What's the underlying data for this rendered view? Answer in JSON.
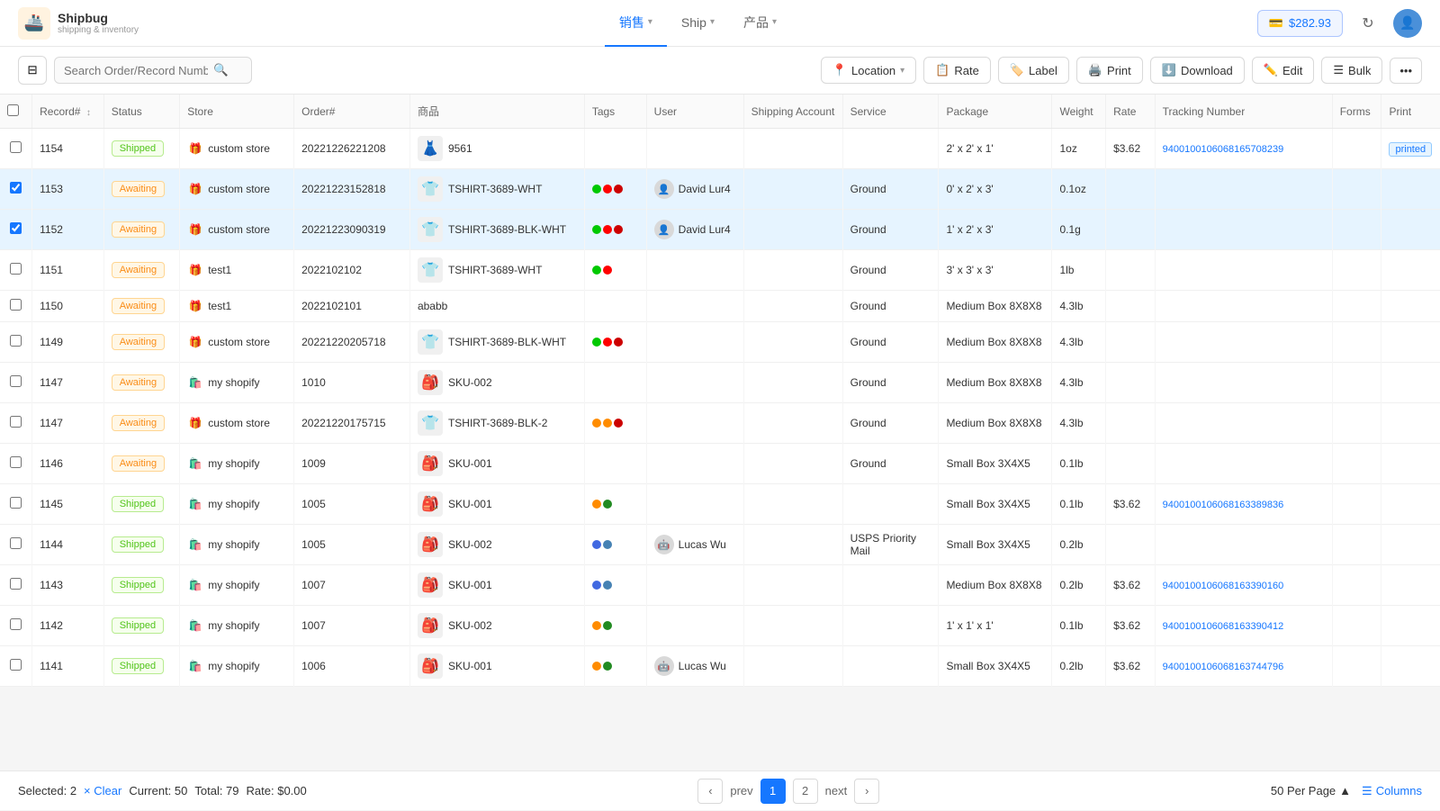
{
  "app": {
    "logo_icon": "🚢",
    "logo_title": "Shipbug",
    "logo_subtitle": "shipping & inventory"
  },
  "nav": {
    "items": [
      {
        "id": "sales",
        "label": "销售",
        "active": true,
        "has_dropdown": true
      },
      {
        "id": "ship",
        "label": "Ship",
        "active": false,
        "has_dropdown": true
      },
      {
        "id": "products",
        "label": "产品",
        "active": false,
        "has_dropdown": true
      }
    ]
  },
  "header": {
    "balance": "$282.93",
    "balance_icon": "💳",
    "refresh_icon": "↻",
    "avatar_text": "U"
  },
  "toolbar": {
    "search_placeholder": "Search Order/Record Number",
    "filter_icon": "⊟",
    "search_icon": "🔍",
    "buttons": [
      {
        "id": "location",
        "label": "Location",
        "icon": "📍",
        "has_dropdown": true
      },
      {
        "id": "rate",
        "label": "Rate",
        "icon": "📋"
      },
      {
        "id": "label",
        "label": "Label",
        "icon": "🏷️"
      },
      {
        "id": "print",
        "label": "Print",
        "icon": "🖨️"
      },
      {
        "id": "download",
        "label": "Download",
        "icon": "⬇️"
      },
      {
        "id": "edit",
        "label": "Edit",
        "icon": "✏️"
      },
      {
        "id": "bulk",
        "label": "Bulk",
        "icon": "☰"
      },
      {
        "id": "more",
        "label": "...",
        "icon": ""
      }
    ]
  },
  "table": {
    "columns": [
      "Record#",
      "Status",
      "Store",
      "Order#",
      "商品",
      "Tags",
      "User",
      "Shipping Account",
      "Service",
      "Package",
      "Weight",
      "Rate",
      "Tracking Number",
      "Forms",
      "Print"
    ],
    "rows": [
      {
        "id": 1154,
        "status": "Shipped",
        "status_type": "shipped",
        "store": "custom store",
        "store_icon": "🎁",
        "order": "20221226221208",
        "product": "9561",
        "product_img": "👗",
        "tags": [],
        "user": "",
        "shipping_account": "",
        "service": "",
        "package": "2' x 2' x 1'",
        "weight": "1oz",
        "rate": "$3.62",
        "tracking": "9400100106068165708239",
        "forms": "",
        "print_status": "printed",
        "checked": false,
        "row_selected": false
      },
      {
        "id": 1153,
        "status": "Awaiting",
        "status_type": "awaiting",
        "store": "custom store",
        "store_icon": "🎁",
        "order": "20221223152818",
        "product": "TSHIRT-3689-WHT",
        "product_img": "👕",
        "tags": [
          "#00c900",
          "#ff0000",
          "#cc0000"
        ],
        "user": "David Lur4",
        "user_avatar": "👤",
        "shipping_account": "",
        "service": "Ground",
        "package": "0' x 2' x 3'",
        "weight": "0.1oz",
        "rate": "",
        "tracking": "",
        "forms": "",
        "print_status": "",
        "checked": true,
        "row_selected": true
      },
      {
        "id": 1152,
        "status": "Awaiting",
        "status_type": "awaiting",
        "store": "custom store",
        "store_icon": "🎁",
        "order": "20221223090319",
        "product": "TSHIRT-3689-BLK-WHT",
        "product_img": "👕",
        "tags": [
          "#00c900",
          "#ff0000",
          "#cc0000"
        ],
        "user": "David Lur4",
        "user_avatar": "👤",
        "shipping_account": "",
        "service": "Ground",
        "package": "1' x 2' x 3'",
        "weight": "0.1g",
        "rate": "",
        "tracking": "",
        "forms": "",
        "print_status": "",
        "checked": true,
        "row_selected": true
      },
      {
        "id": 1151,
        "status": "Awaiting",
        "status_type": "awaiting",
        "store": "test1",
        "store_icon": "🎁",
        "order": "2022102102",
        "product": "TSHIRT-3689-WHT",
        "product_img": "👕",
        "tags": [
          "#00c900",
          "#ff0000"
        ],
        "user": "",
        "shipping_account": "",
        "service": "Ground",
        "package": "3' x 3' x 3'",
        "weight": "1lb",
        "rate": "",
        "tracking": "",
        "forms": "",
        "print_status": "",
        "checked": false,
        "row_selected": false
      },
      {
        "id": 1150,
        "status": "Awaiting",
        "status_type": "awaiting",
        "store": "test1",
        "store_icon": "🎁",
        "order": "2022102101",
        "product": "ababb",
        "product_img": "",
        "tags": [],
        "user": "",
        "shipping_account": "",
        "service": "Ground",
        "package": "Medium Box 8X8X8",
        "weight": "4.3lb",
        "rate": "",
        "tracking": "",
        "forms": "",
        "print_status": "",
        "checked": false,
        "row_selected": false
      },
      {
        "id": 1149,
        "status": "Awaiting",
        "status_type": "awaiting",
        "store": "custom store",
        "store_icon": "🎁",
        "order": "20221220205718",
        "product": "TSHIRT-3689-BLK-WHT",
        "product_img": "👕",
        "tags": [
          "#00c900",
          "#ff0000",
          "#cc0000"
        ],
        "user": "",
        "shipping_account": "",
        "service": "Ground",
        "package": "Medium Box 8X8X8",
        "weight": "4.3lb",
        "rate": "",
        "tracking": "",
        "forms": "",
        "print_status": "",
        "checked": false,
        "row_selected": false
      },
      {
        "id": 1147,
        "status": "Awaiting",
        "status_type": "awaiting",
        "store": "my shopify",
        "store_icon": "🛍️",
        "order": "1010",
        "product": "SKU-002",
        "product_img": "🎒",
        "tags": [],
        "user": "",
        "shipping_account": "",
        "service": "Ground",
        "package": "Medium Box 8X8X8",
        "weight": "4.3lb",
        "rate": "",
        "tracking": "",
        "forms": "",
        "print_status": "",
        "checked": false,
        "row_selected": false
      },
      {
        "id": 1147,
        "status": "Awaiting",
        "status_type": "awaiting",
        "store": "custom store",
        "store_icon": "🎁",
        "order": "20221220175715",
        "product": "TSHIRT-3689-BLK-2",
        "product_img": "👕",
        "tags": [
          "#ff8c00",
          "#ff8c00",
          "#cc0000"
        ],
        "user": "",
        "shipping_account": "",
        "service": "Ground",
        "package": "Medium Box 8X8X8",
        "weight": "4.3lb",
        "rate": "",
        "tracking": "",
        "forms": "",
        "print_status": "",
        "checked": false,
        "row_selected": false
      },
      {
        "id": 1146,
        "status": "Awaiting",
        "status_type": "awaiting",
        "store": "my shopify",
        "store_icon": "🛍️",
        "order": "1009",
        "product": "SKU-001",
        "product_img": "🎒",
        "tags": [],
        "user": "",
        "shipping_account": "",
        "service": "Ground",
        "package": "Small Box 3X4X5",
        "weight": "0.1lb",
        "rate": "",
        "tracking": "",
        "forms": "",
        "print_status": "",
        "checked": false,
        "row_selected": false
      },
      {
        "id": 1145,
        "status": "Shipped",
        "status_type": "shipped",
        "store": "my shopify",
        "store_icon": "🛍️",
        "order": "1005",
        "product": "SKU-001",
        "product_img": "🎒",
        "tags": [
          "#ff8c00",
          "#228b22"
        ],
        "user": "",
        "shipping_account": "",
        "service": "",
        "package": "Small Box 3X4X5",
        "weight": "0.1lb",
        "rate": "$3.62",
        "tracking": "9400100106068163389836",
        "forms": "",
        "print_status": "",
        "checked": false,
        "row_selected": false
      },
      {
        "id": 1144,
        "status": "Shipped",
        "status_type": "shipped",
        "store": "my shopify",
        "store_icon": "🛍️",
        "order": "1005",
        "product": "SKU-002",
        "product_img": "🎒",
        "tags": [
          "#4169e1",
          "#4682b4"
        ],
        "user": "Lucas Wu",
        "user_avatar": "🤖",
        "shipping_account": "",
        "service": "USPS Priority Mail",
        "package": "Small Box 3X4X5",
        "weight": "0.2lb",
        "rate": "",
        "tracking": "",
        "forms": "",
        "print_status": "",
        "checked": false,
        "row_selected": false
      },
      {
        "id": 1143,
        "status": "Shipped",
        "status_type": "shipped",
        "store": "my shopify",
        "store_icon": "🛍️",
        "order": "1007",
        "product": "SKU-001",
        "product_img": "🎒",
        "tags": [
          "#4169e1",
          "#4682b4"
        ],
        "user": "",
        "shipping_account": "",
        "service": "",
        "package": "Medium Box 8X8X8",
        "weight": "0.2lb",
        "rate": "$3.62",
        "tracking": "9400100106068163390160",
        "forms": "",
        "print_status": "",
        "checked": false,
        "row_selected": false
      },
      {
        "id": 1142,
        "status": "Shipped",
        "status_type": "shipped",
        "store": "my shopify",
        "store_icon": "🛍️",
        "order": "1007",
        "product": "SKU-002",
        "product_img": "🎒",
        "tags": [
          "#ff8c00",
          "#228b22"
        ],
        "user": "",
        "shipping_account": "",
        "service": "",
        "package": "1' x 1' x 1'",
        "weight": "0.1lb",
        "rate": "$3.62",
        "tracking": "9400100106068163390412",
        "forms": "",
        "print_status": "",
        "checked": false,
        "row_selected": false
      },
      {
        "id": 1141,
        "status": "Shipped",
        "status_type": "shipped",
        "store": "my shopify",
        "store_icon": "🛍️",
        "order": "1006",
        "product": "SKU-001",
        "product_img": "🎒",
        "tags": [
          "#ff8c00",
          "#228b22"
        ],
        "user": "Lucas Wu",
        "user_avatar": "🤖",
        "shipping_account": "",
        "service": "",
        "package": "Small Box 3X4X5",
        "weight": "0.2lb",
        "rate": "$3.62",
        "tracking": "9400100106068163744796",
        "forms": "",
        "print_status": "",
        "checked": false,
        "row_selected": false
      }
    ]
  },
  "footer": {
    "selected_count": "Selected: 2",
    "clear_label": "× Clear",
    "current": "Current: 50",
    "total": "Total: 79",
    "rate_info": "Rate: $0.00",
    "prev_label": "prev",
    "next_label": "next",
    "current_page": 1,
    "total_pages": 2,
    "per_page": "50 Per Page",
    "columns_label": "Columns"
  }
}
